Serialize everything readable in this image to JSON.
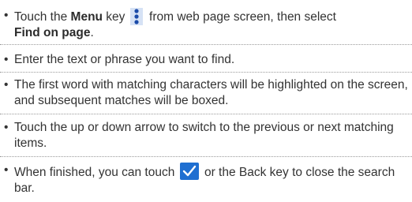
{
  "bullet_char": "•",
  "items": [
    {
      "t1": "Touch the ",
      "b1": "Menu",
      "t2": " key ",
      "t3": " from web page screen, then select ",
      "b2": "Find on page",
      "t4": "."
    },
    {
      "t1": "Enter the text or phrase you want to find."
    },
    {
      "t1": "The first word with matching characters will be highlighted on the screen, and subsequent matches will be boxed."
    },
    {
      "t1": "Touch the up or down arrow to switch to the previous or next matching items."
    },
    {
      "t1": "When finished, you can touch ",
      "t2": " or the Back key to close the search bar."
    }
  ],
  "icons": {
    "menu": "menu-dots-icon",
    "confirm": "checkmark-icon"
  },
  "colors": {
    "menu_icon": "#1a4aa8",
    "check_bg": "#1f6fd1",
    "text": "#333333"
  }
}
